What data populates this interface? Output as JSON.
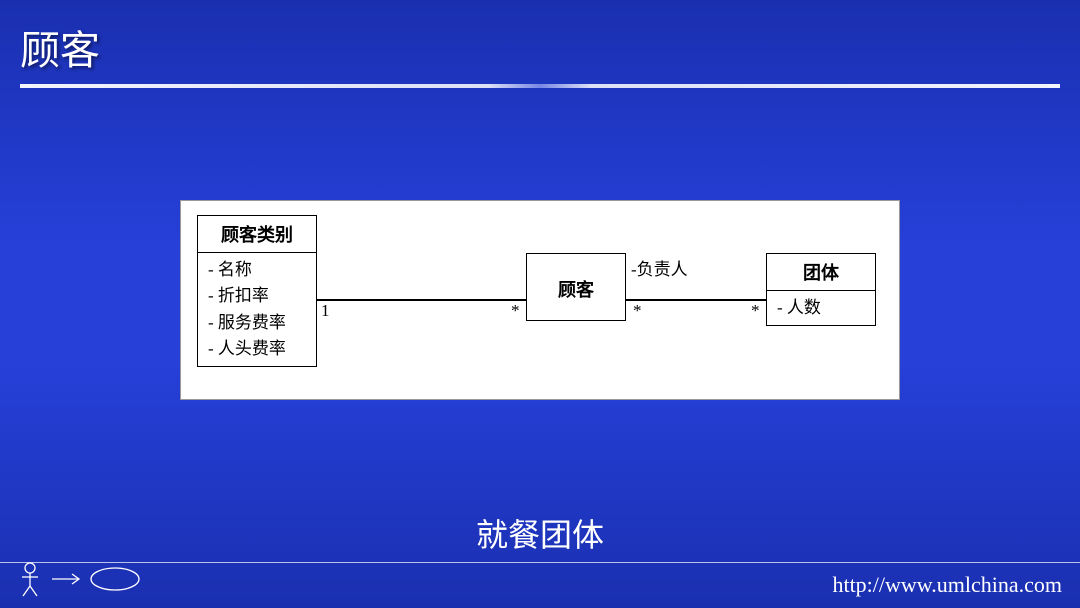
{
  "slide": {
    "title": "顾客",
    "subtitle": "就餐团体"
  },
  "diagram": {
    "classes": {
      "category": {
        "name": "顾客类别",
        "attrs": {
          "a0": "-   名称",
          "a1": "-   折扣率",
          "a2": "-   服务费率",
          "a3": "-   人头费率"
        }
      },
      "customer": {
        "name": "顾客"
      },
      "group": {
        "name": "团体",
        "attrs": {
          "a0": "-   人数"
        }
      }
    },
    "associations": {
      "cat_cust": {
        "left_mult": "1",
        "right_mult": "*"
      },
      "cust_group": {
        "role": "-负责人",
        "left_mult": "*",
        "right_mult": "*"
      }
    }
  },
  "footer": {
    "url": "http://www.umlchina.com"
  }
}
